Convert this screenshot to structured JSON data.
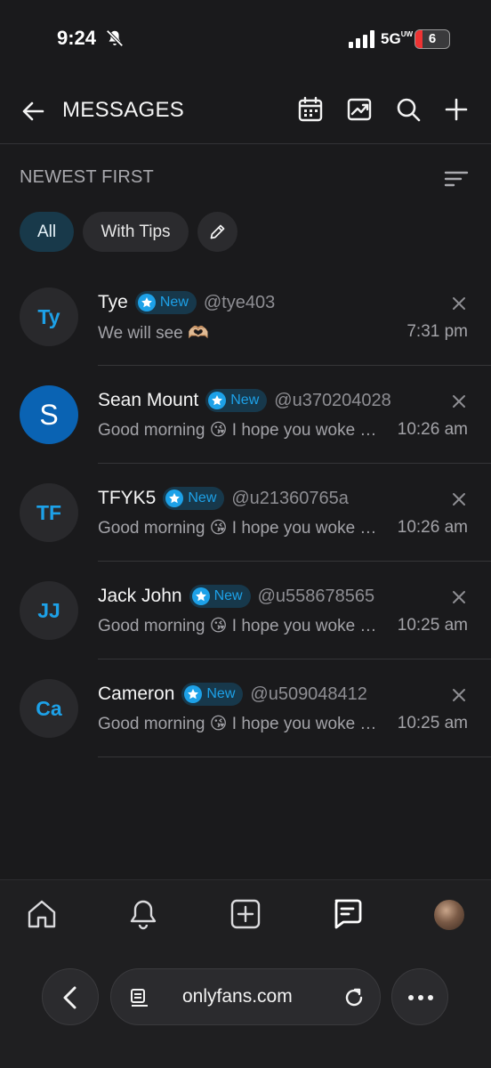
{
  "status_bar": {
    "time": "9:24",
    "network": "5G",
    "network_sub": "UW",
    "battery": "6"
  },
  "header": {
    "title": "MESSAGES"
  },
  "sort": {
    "label": "NEWEST FIRST"
  },
  "filters": [
    {
      "label": "All",
      "active": true
    },
    {
      "label": "With Tips",
      "active": false
    }
  ],
  "conversations": [
    {
      "initials": "Ty",
      "name": "Tye",
      "badge": "New",
      "handle": "@tye403",
      "preview": "We will see 🫶🏼",
      "time": "7:31 pm",
      "avatar_style": "dark"
    },
    {
      "initials": "S",
      "name": "Sean Mount",
      "badge": "New",
      "handle": "@u370204028",
      "preview": "Good morning 😘 I hope you woke …",
      "time": "10:26 am",
      "avatar_style": "blue"
    },
    {
      "initials": "TF",
      "name": "TFYK5",
      "badge": "New",
      "handle": "@u21360765a",
      "preview": "Good morning 😘 I hope you woke …",
      "time": "10:26 am",
      "avatar_style": "dark"
    },
    {
      "initials": "JJ",
      "name": "Jack John",
      "badge": "New",
      "handle": "@u558678565",
      "preview": "Good morning 😘 I hope you woke …",
      "time": "10:25 am",
      "avatar_style": "dark"
    },
    {
      "initials": "Ca",
      "name": "Cameron",
      "badge": "New",
      "handle": "@u509048412",
      "preview": "Good morning 😘 I hope you woke …",
      "time": "10:25 am",
      "avatar_style": "dark"
    }
  ],
  "browser": {
    "url": "onlyfans.com"
  },
  "colors": {
    "accent": "#1da1e8",
    "background": "#1a1a1c",
    "active_chip": "#18394a",
    "avatar_blue": "#0a63b3"
  },
  "icons": {
    "header": [
      "back-arrow-icon",
      "calendar-icon",
      "chart-image-icon",
      "search-icon",
      "plus-icon"
    ],
    "nav": [
      "home-icon",
      "bell-icon",
      "add-post-icon",
      "messages-icon",
      "profile-avatar"
    ]
  }
}
